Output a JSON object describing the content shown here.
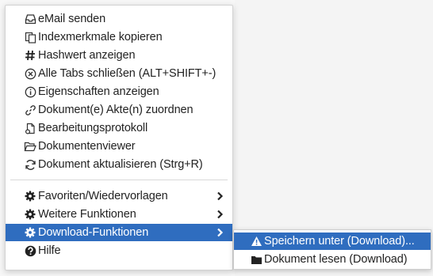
{
  "context_menu": {
    "items": [
      {
        "label": "eMail senden",
        "icon": "tray-icon"
      },
      {
        "label": "Indexmerkmale kopieren",
        "icon": "copy-icon"
      },
      {
        "label": "Hashwert anzeigen",
        "icon": "hash-icon"
      },
      {
        "label": "Alle Tabs schließen (ALT+SHIFT+-)",
        "icon": "close-circle-icon"
      },
      {
        "label": "Eigenschaften anzeigen",
        "icon": "info-circle-icon"
      },
      {
        "label": "Dokument(e) Akte(n) zuordnen",
        "icon": "link-icon"
      },
      {
        "label": "Bearbeitungsprotokoll",
        "icon": "audio-file-icon"
      },
      {
        "label": "Dokumentenviewer",
        "icon": "folder-open-icon"
      },
      {
        "label": "Dokument aktualisieren (Strg+R)",
        "icon": "refresh-icon"
      }
    ],
    "sub_items": [
      {
        "label": "Favoriten/Wiedervorlagen",
        "icon": "gear-icon"
      },
      {
        "label": "Weitere Funktionen",
        "icon": "gear-icon"
      },
      {
        "label": "Download-Funktionen",
        "icon": "gear-icon",
        "active": true
      },
      {
        "label": "Hilfe",
        "icon": "question-circle-icon"
      }
    ]
  },
  "download_submenu": {
    "items": [
      {
        "label": "Speichern unter (Download)...",
        "icon": "warning-triangle-icon",
        "active": true
      },
      {
        "label": "Dokument lesen (Download)",
        "icon": "folder-icon"
      }
    ]
  },
  "colors": {
    "highlight": "#2f6dbf",
    "text": "#222222"
  }
}
